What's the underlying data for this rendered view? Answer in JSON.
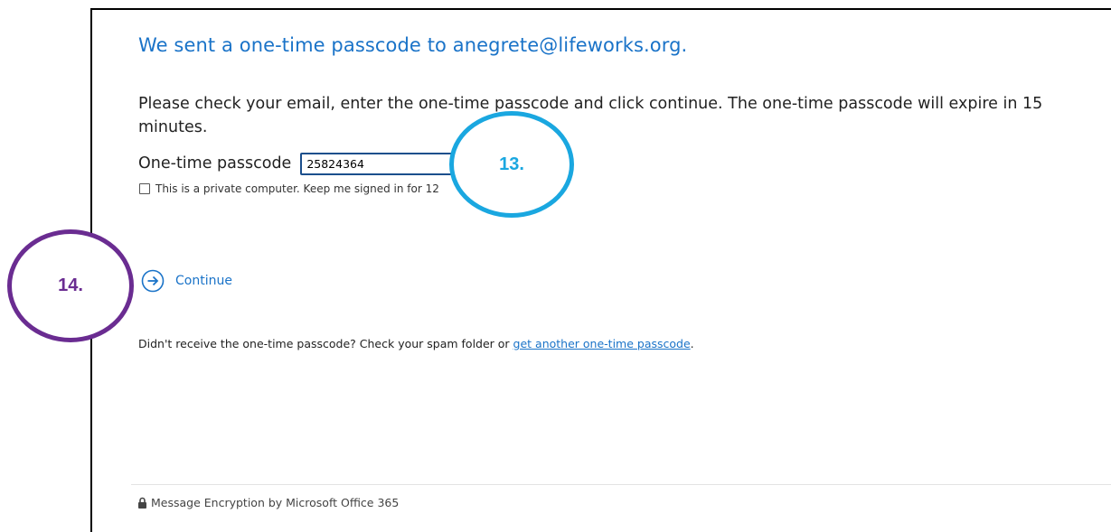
{
  "page": {
    "heading": "We sent a one-time passcode to anegrete@lifeworks.org.",
    "instructions": "Please check your email, enter the one-time passcode and click continue. The one-time passcode will expire in 15 minutes."
  },
  "passcode": {
    "label": "One-time passcode",
    "value": "25824364"
  },
  "keep_signed_in": {
    "label": "This is a private computer. Keep me signed in for 12",
    "checked": false
  },
  "continue": {
    "label": "Continue",
    "icon": "arrow-right-circle-icon"
  },
  "resend": {
    "text": "Didn't receive the one-time passcode? Check your spam folder or ",
    "link_label": "get another one-time passcode",
    "suffix": "."
  },
  "footer": {
    "icon": "lock-icon",
    "text": "Message Encryption by Microsoft Office 365"
  },
  "annotations": {
    "step_13": "13.",
    "step_14": "14."
  },
  "colors": {
    "accent": "#1a73c8",
    "callout_13": "#1aa7e0",
    "callout_14": "#6a2c91",
    "input_border": "#1b4f8c"
  }
}
